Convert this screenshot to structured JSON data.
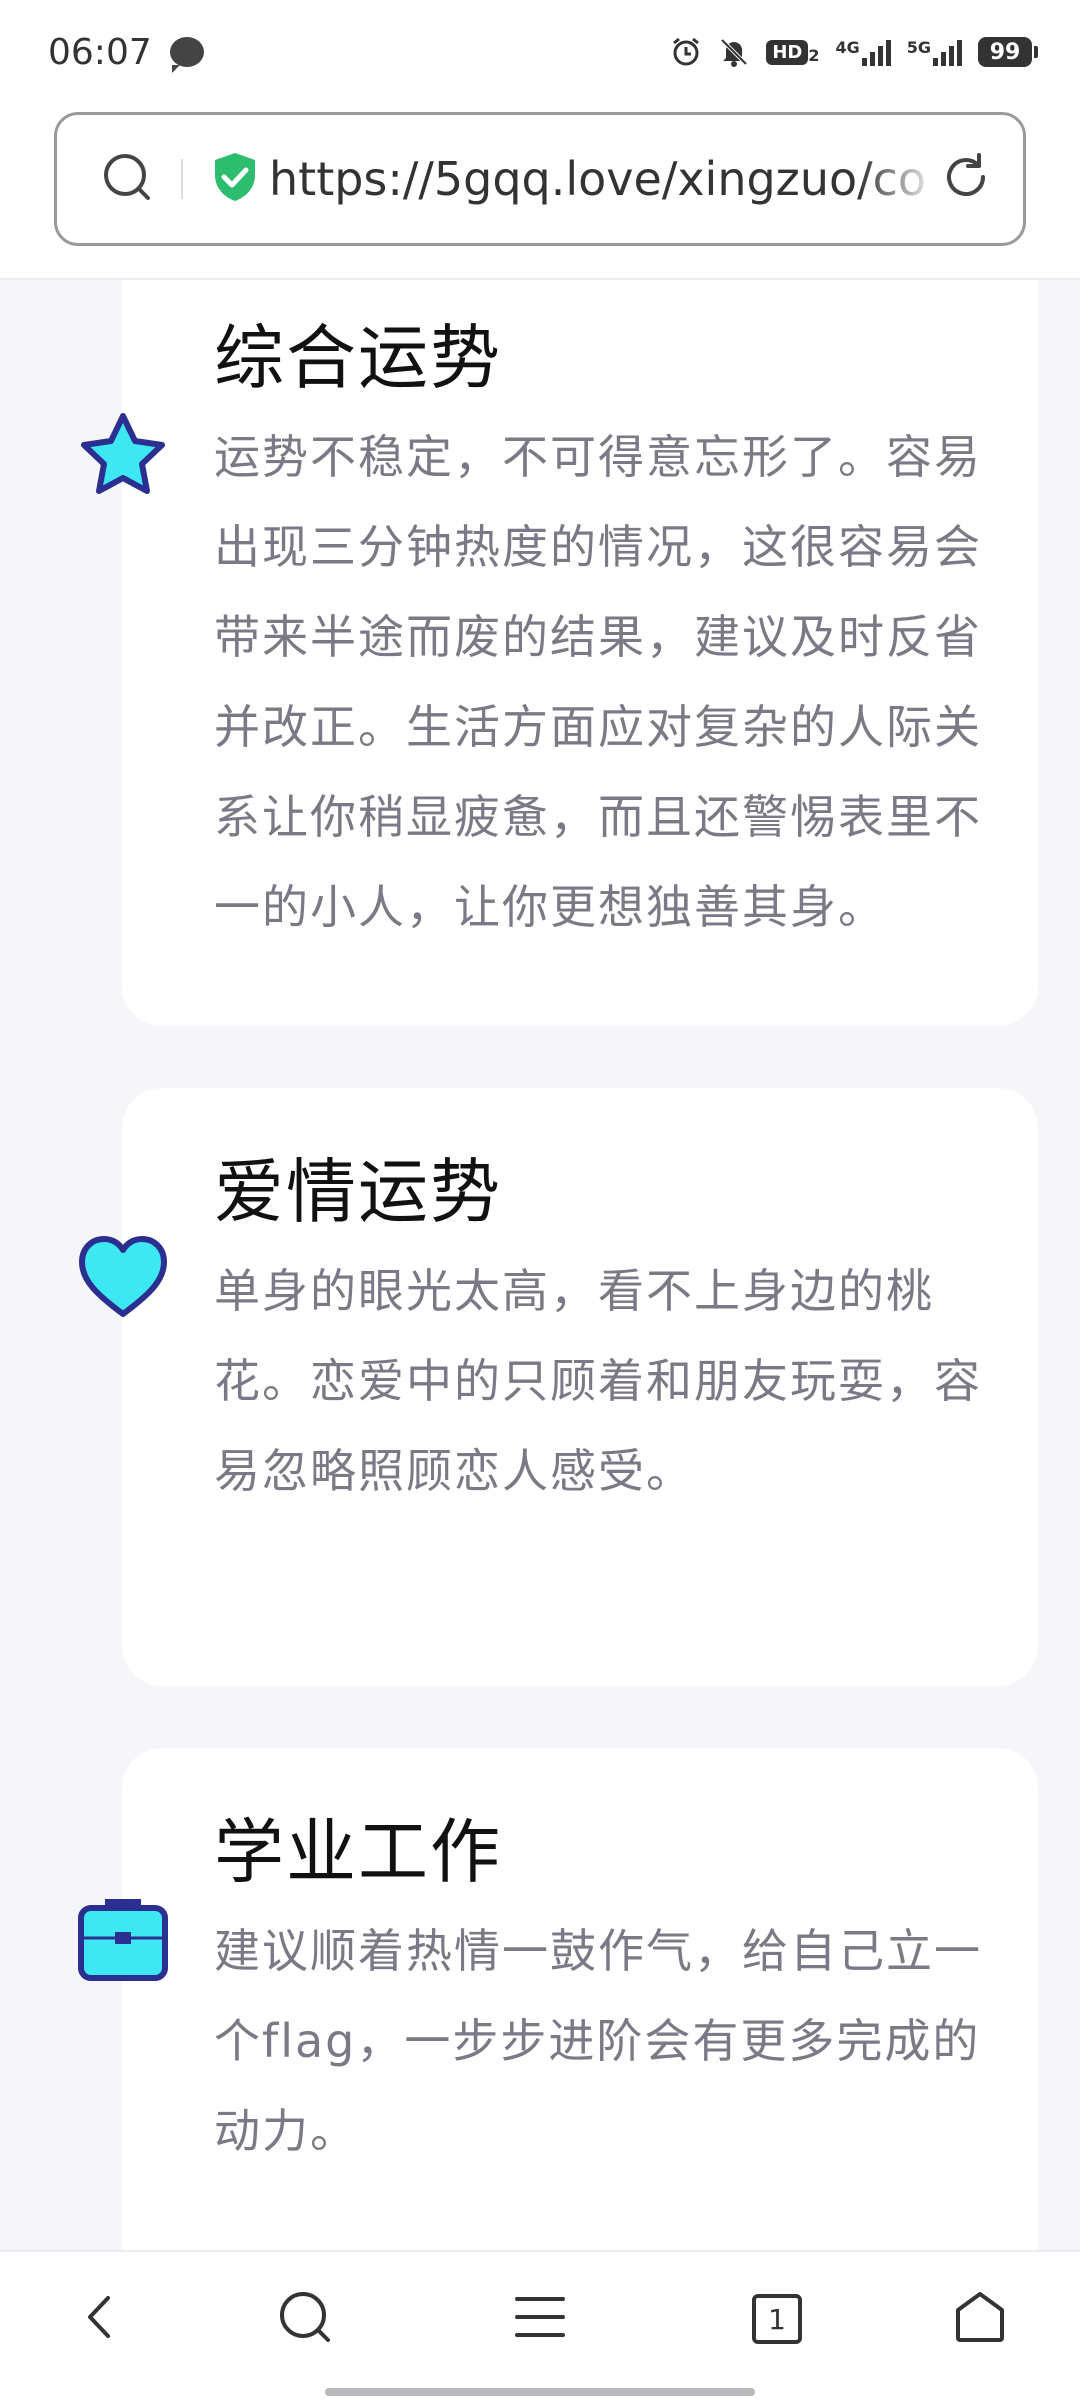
{
  "status_bar": {
    "time": "06:07",
    "network_1": "4G",
    "network_2": "5G",
    "hd_label": "HD",
    "hd_sub": "2",
    "battery": "99"
  },
  "address_bar": {
    "url": "https://5gqq.love/xingzuo/co"
  },
  "cards": [
    {
      "title": "综合运势",
      "icon": "star-icon",
      "lines": [
        "运势不稳定，不可得意忘形了。容易",
        "出现三分钟热度的情况，这很容易会",
        "带来半途而废的结果，建议及时反省",
        "并改正。生活方面应对复杂的人际关",
        "系让你稍显疲惫，而且还警惕表里不",
        "一的小人，让你更想独善其身。"
      ]
    },
    {
      "title": "爱情运势",
      "icon": "heart-icon",
      "lines": [
        "单身的眼光太高，看不上身边的桃",
        "花。恋爱中的只顾着和朋友玩耍，容",
        "易忽略照顾恋人感受。"
      ]
    },
    {
      "title": "学业工作",
      "icon": "briefcase-icon",
      "lines": [
        "建议顺着热情一鼓作气，给自己立一",
        "个flag，一步步进阶会有更多完成的",
        "动力。"
      ]
    }
  ],
  "bottom_nav": {
    "tab_count": "1"
  },
  "colors": {
    "icon_fill": "#3ee8f3",
    "icon_outline": "#2b2f8f",
    "shield": "#2dbd6e"
  }
}
